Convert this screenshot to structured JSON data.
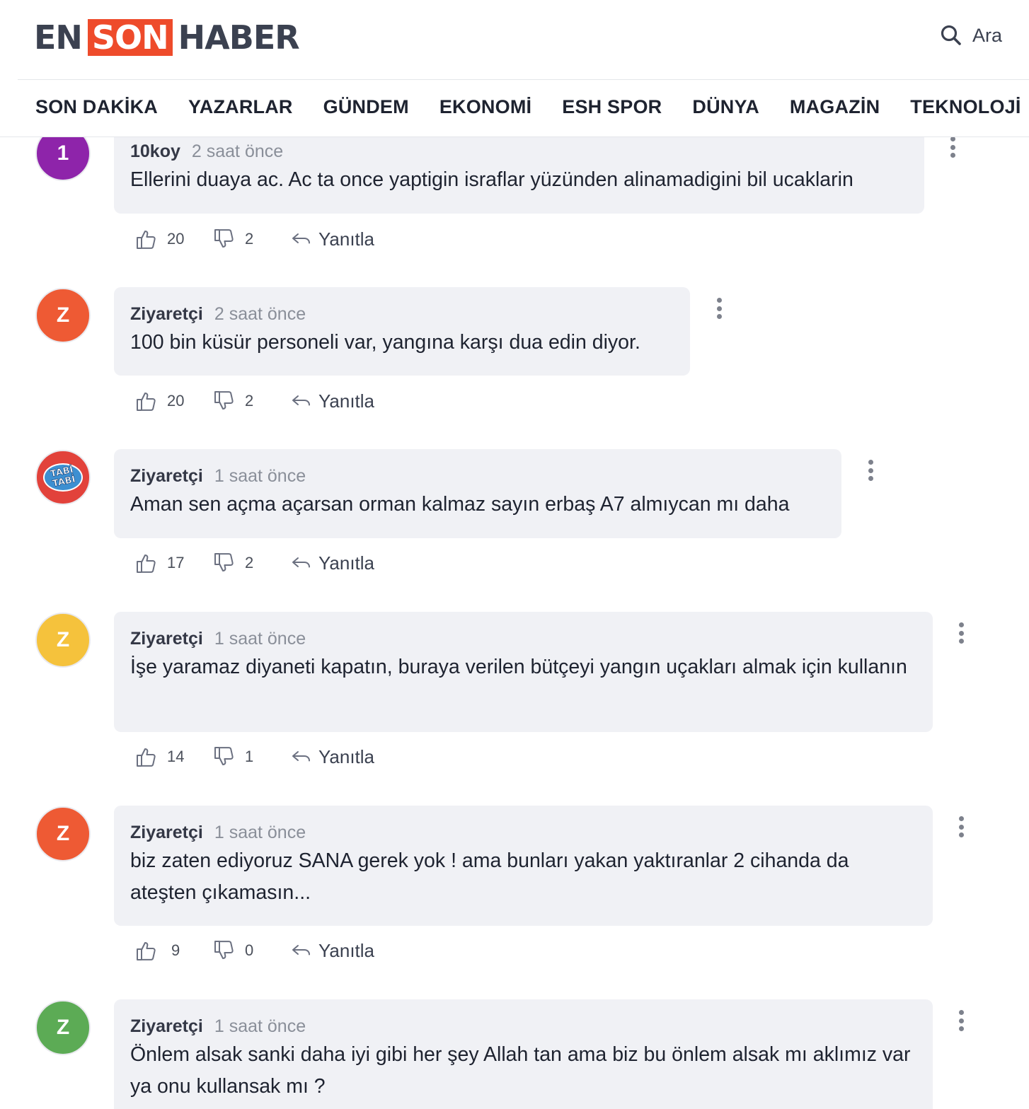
{
  "logo": {
    "en": "EN",
    "son": "SON",
    "haber": "HABER"
  },
  "search": {
    "label": "Ara"
  },
  "nav": [
    "SON DAKİKA",
    "YAZARLAR",
    "GÜNDEM",
    "EKONOMİ",
    "ESH SPOR",
    "DÜNYA",
    "MAGAZİN",
    "TEKNOLOJİ"
  ],
  "reply_label": "Yanıtla",
  "colors": {
    "brand": "#ee4b2b",
    "purple": "#8e24aa",
    "orange": "#ee5a34",
    "yellow": "#f5c23c",
    "green": "#5cab55",
    "bubble": "#f0f1f5"
  },
  "comments": [
    {
      "avatar": "1",
      "author": "10koy",
      "time": "2 saat önce",
      "text": "Ellerini duaya ac. Ac ta once yaptigin israflar yüzünden alinamadigini bil ucaklarin",
      "likes": "20",
      "dislikes": "2"
    },
    {
      "avatar": "Z",
      "author": "Ziyaretçi",
      "time": "2 saat önce",
      "text": "100 bin küsür personeli var, yangına karşı dua edin diyor.",
      "likes": "20",
      "dislikes": "2"
    },
    {
      "avatar": "TABİ TABİ",
      "author": "Ziyaretçi",
      "time": "1 saat önce",
      "text": "Aman sen açma açarsan orman kalmaz sayın erbaş A7 almıycan mı daha",
      "likes": "17",
      "dislikes": "2"
    },
    {
      "avatar": "Z",
      "author": "Ziyaretçi",
      "time": "1 saat önce",
      "text": "İşe yaramaz diyaneti kapatın, buraya verilen bütçeyi yangın uçakları almak için kullanın",
      "likes": "14",
      "dislikes": "1"
    },
    {
      "avatar": "Z",
      "author": "Ziyaretçi",
      "time": "1 saat önce",
      "text": "biz zaten ediyoruz SANA gerek yok ! ama bunları yakan yaktıranlar 2 cihanda da ateşten çıkamasın...",
      "likes": "9",
      "dislikes": "0"
    },
    {
      "avatar": "Z",
      "author": "Ziyaretçi",
      "time": "1 saat önce",
      "text": "Önlem alsak sanki daha iyi gibi her şey Allah tan ama biz bu önlem alsak mı aklımız var ya onu kullansak mı ?",
      "likes": "",
      "dislikes": ""
    }
  ]
}
